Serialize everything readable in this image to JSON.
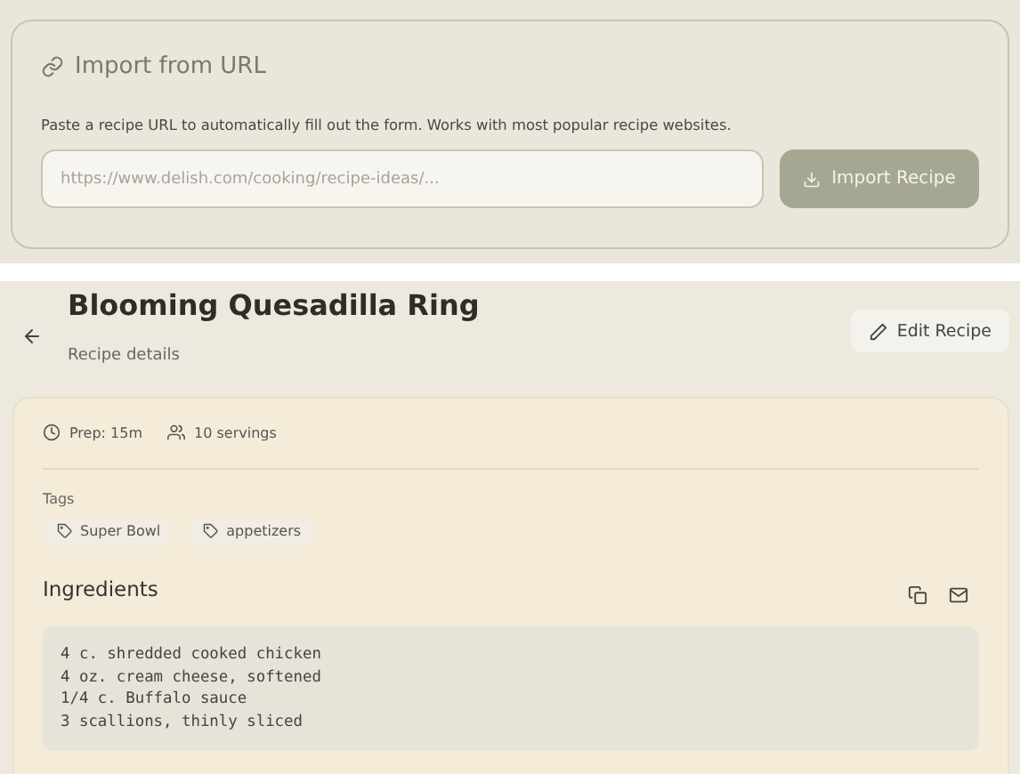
{
  "import_panel": {
    "title": "Import from URL",
    "description": "Paste a recipe URL to automatically fill out the form. Works with most popular recipe websites.",
    "url_field": {
      "placeholder": "https://www.delish.com/cooking/recipe-ideas/..."
    },
    "button": "Import Recipe"
  },
  "recipe": {
    "title": "Blooming Quesadilla Ring",
    "subtitle": "Recipe details",
    "edit_button": "Edit Recipe",
    "prep": "Prep: 15m",
    "servings": "10 servings",
    "tags_label": "Tags",
    "tags": [
      "Super Bowl",
      "appetizers"
    ],
    "ingredients_title": "Ingredients",
    "ingredients": [
      "4 c. shredded cooked chicken",
      "4 oz. cream cheese, softened",
      "1/4 c. Buffalo sauce",
      "3 scallions, thinly sliced"
    ]
  }
}
